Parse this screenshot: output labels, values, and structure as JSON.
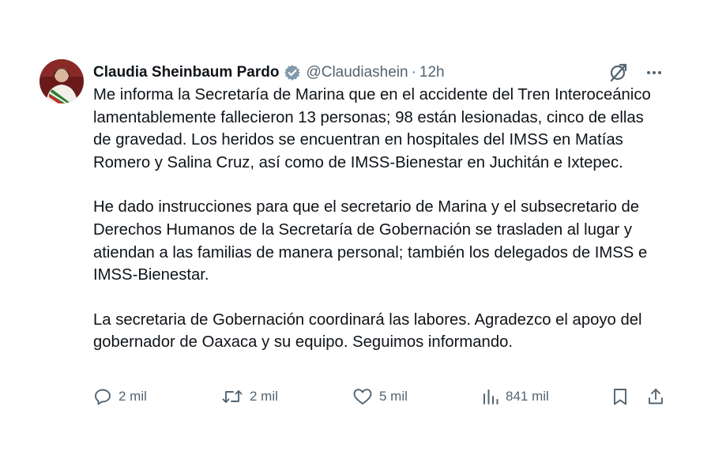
{
  "tweet": {
    "author": {
      "display_name": "Claudia Sheinbaum Pardo",
      "handle": "@Claudiashein",
      "separator": "·",
      "time": "12h",
      "verified_icon": "verified-badge-icon"
    },
    "paragraphs": [
      "Me informa la Secretaría de Marina que en el accidente del Tren Interoceánico lamentablemente fallecieron 13 personas; 98 están lesionadas, cinco de ellas de gravedad. Los heridos se encuentran en hospitales del IMSS en Matías Romero y Salina Cruz, así como de IMSS-Bienestar en Juchitán e Ixtepec.",
      "He dado instrucciones para que el secretario de Marina y el subsecretario de Derechos Humanos de la Secretaría de Gobernación se trasladen al lugar y atiendan a las familias de manera personal; también los delegados de IMSS e IMSS-Bienestar.",
      "La secretaria de Gobernación coordinará las labores. Agradezco el apoyo del gobernador de Oaxaca y su equipo. Seguimos informando."
    ],
    "actions": {
      "replies": "2 mil",
      "reposts": "2 mil",
      "likes": "5 mil",
      "views": "841 mil"
    },
    "icons": {
      "grok": "grok-icon",
      "more": "more-options-icon",
      "reply": "reply-icon",
      "repost": "repost-icon",
      "like": "heart-icon",
      "views": "views-chart-icon",
      "bookmark": "bookmark-icon",
      "share": "share-icon"
    }
  },
  "colors": {
    "text": "#0f1419",
    "secondary": "#536471",
    "verified": "#829aab"
  }
}
